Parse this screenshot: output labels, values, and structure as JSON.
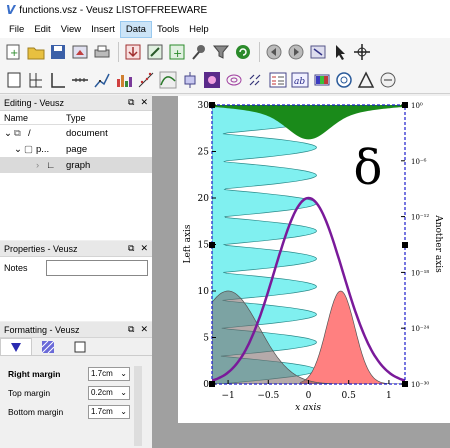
{
  "window": {
    "title": "functions.vsz - Veusz  LISTOFFREEWARE"
  },
  "menu": [
    "File",
    "Edit",
    "View",
    "Insert",
    "Data",
    "Tools",
    "Help"
  ],
  "menu_active": "Data",
  "editing": {
    "title": "Editing - Veusz",
    "col_name": "Name",
    "col_type": "Type",
    "rows": [
      {
        "name": "/",
        "type": "document"
      },
      {
        "name": "p...",
        "type": "page"
      },
      {
        "name": "graph",
        "type": "graph"
      }
    ]
  },
  "properties": {
    "title": "Properties - Veusz",
    "notes_label": "Notes",
    "notes_value": ""
  },
  "formatting": {
    "title": "Formatting - Veusz",
    "rows": [
      {
        "label": "Right margin",
        "value": "1.7cm"
      },
      {
        "label": "Top margin",
        "value": "0.2cm"
      },
      {
        "label": "Bottom margin",
        "value": "1.7cm"
      }
    ]
  },
  "plot": {
    "left_axis_label": "Left axis",
    "right_axis_label": "Another axis",
    "x_axis_label": "x axis",
    "left_ticks": [
      "0",
      "5",
      "10",
      "15",
      "20",
      "25",
      "30"
    ],
    "x_ticks": [
      "−1",
      "−0.5",
      "0",
      "0.5",
      "1"
    ],
    "right_ticks": [
      "10⁰",
      "10⁻⁶",
      "10⁻¹²",
      "10⁻¹⁸",
      "10⁻²⁴",
      "10⁻³⁰"
    ],
    "annotation": "δ",
    "colors": {
      "cyan": "#80f0f0",
      "green": "#1a8a1a",
      "pink": "#ff8080",
      "purple": "#7a1a9a",
      "border": "#1a1acc"
    }
  }
}
